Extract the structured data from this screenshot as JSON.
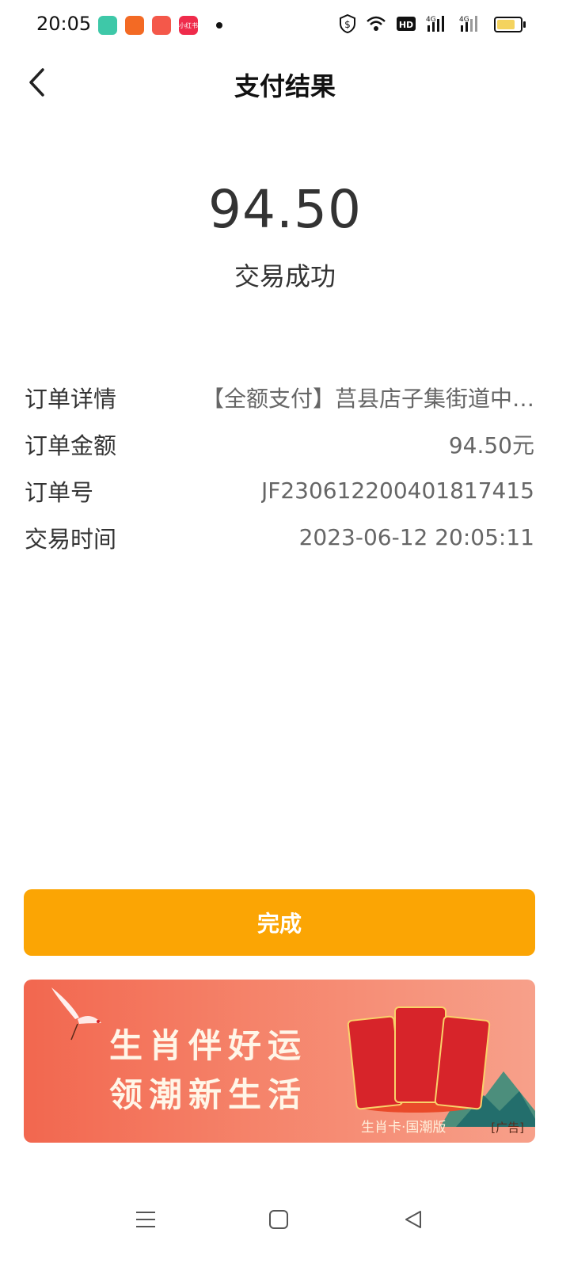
{
  "status_bar": {
    "time": "20:05",
    "app_icons": [
      {
        "name": "app-green-icon",
        "color": "#3ec8a8"
      },
      {
        "name": "app-orange-icon",
        "color": "#f36a24"
      },
      {
        "name": "app-orange2-icon",
        "color": "#f4584a"
      },
      {
        "name": "app-red-icon",
        "color": "#ef2b4b",
        "text": "小红书"
      }
    ],
    "system_icons": [
      "shield-icon",
      "wifi-icon",
      "hd-icon",
      "signal-4g-icon",
      "signal-4g-icon",
      "battery-icon"
    ]
  },
  "header": {
    "title": "支付结果"
  },
  "result": {
    "amount": "94.50",
    "status": "交易成功"
  },
  "details": [
    {
      "label": "订单详情",
      "value": "【全额支付】莒县店子集街道中…"
    },
    {
      "label": "订单金额",
      "value": "94.50元"
    },
    {
      "label": "订单号",
      "value": "JF230612200401817415"
    },
    {
      "label": "交易时间",
      "value": "2023-06-12 20:05:11"
    }
  ],
  "done_button": {
    "label": "完成"
  },
  "ad": {
    "line1": "生肖伴好运",
    "line2": "领潮新生活",
    "subtitle": "生肖卡·国潮版",
    "tag": "[广告]"
  },
  "colors": {
    "accent": "#fba504",
    "ad_bg": "#f2674f"
  }
}
